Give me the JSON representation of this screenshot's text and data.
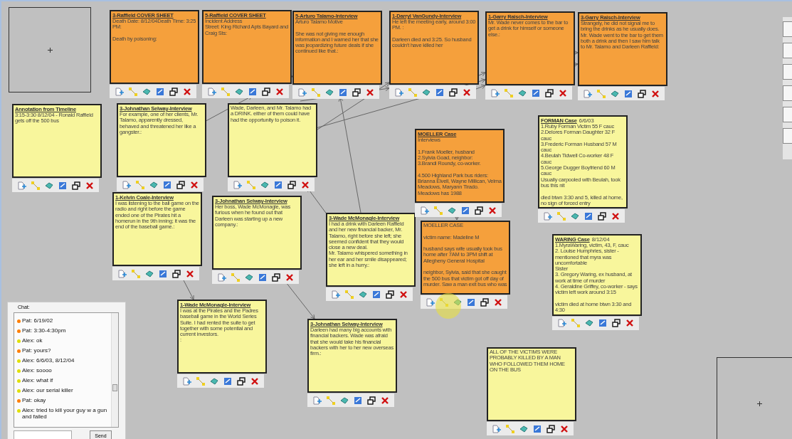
{
  "notes": [
    {
      "title": "3-Raffield COVER SHEET",
      "text": "Death Date: 8/12/04Death Time: 3:25 PM:\n\nDeath by poisoning:",
      "color": "#f5a03c"
    },
    {
      "title": "5-Raffield COVER SHEET",
      "text": "Incident Address\nStreet: King Richard Apts Bayard and Craig Sts:",
      "color": "#f5a03c"
    },
    {
      "title": "5-Arturo Talamo-Interview",
      "text": "Arturo Talamo Motive\n\nShe was not giving me enough information and I warned her that she was jeopardizing future deals if she continued like that.:",
      "color": "#f5a03c"
    },
    {
      "title": "1-Darryl VanGundy-Interview",
      "text": "He left the meeting early, around 3:00 PM. :\n\nDarleen died and 3:25. So husband couldn't have killed her",
      "color": "#f5a03c"
    },
    {
      "title": "1-Garry Raisch-Interview",
      "text": "Mr. Wade never comes to the bar to get a drink for himself or someone else.:",
      "color": "#f5a03c"
    },
    {
      "title": "3-Garry Raisch-Interview",
      "text": "Strangely, he did not signal me to bring the drinks as he usually does.\nMr. Wade went to the bar to get them both a drink and then I saw him talk to Mr. Talamo and Darleen Raffield:",
      "color": "#f5a03c"
    },
    {
      "title": "Annotation from Timeline",
      "text": "3:15-3:30 8/12/04 - Ronald Raffield gets off the 500 bus",
      "color": "#f8f69c"
    },
    {
      "title": "3-Johnathan Selway-Interview",
      "text": "For example, one of her clients, Mr. Talamo, apparently dressed, behaved and threatened her like a gangster.:",
      "color": "#f8f69c"
    },
    {
      "text": "Wade, Darleen, and Mr. Talamo had a DRINK. either of them could have had the opportunity to poison it.",
      "color": "#f8f69c"
    },
    {
      "title": "1-Kelvin Coale-Interview",
      "text": "I was listening to the ball game on the radio and right before the game ended one of the Pirates hit a homerun in the 9th inning; it was the end of the baseball game.:",
      "color": "#f8f69c"
    },
    {
      "title": "3-Johnathan Selway-Interview",
      "text": "Her boss, Wade McMonagle, was furious when he found out that Darleen was starting up a new company.:",
      "color": "#f8f69c"
    },
    {
      "title": "3-Wade McMonagle-Interview",
      "text": "I had a drink with Darleen Raffield and her new financial backer, Mr. Talamo, right before she left; she seemed confident that they would close a new deal.\nMr. Talamo whispered something in her ear and her smile disappeared; she left in a hurry.:",
      "color": "#f8f69c"
    },
    {
      "title": "MOELLER Case",
      "text": "Interviews\n\n1.Frank Moeller, husband\n2.Sylvia Goad, neighbor:\n3.Brandi Roundy, co-worker.\n\n4.500 Highland Park bus riders: Brianna Elvell, Wayne Millican, Velma Meadows, Maryann Tirado. Meadows has 1988",
      "color": "#f5a03c"
    },
    {
      "text": "MOELLER CASE\n\nvictim name: Madeline M\n\nhusband says wife usually took bus home after 7AM to 3PM shift at Allegheny General Hospital\n\nneighbor, Sylvia, said that she caught the 500 bus that victim got off day of murder. Saw a man exit bus who was",
      "color": "#f5a03c"
    },
    {
      "title": "FORMAN Case",
      "date": "6/6/03",
      "text": "1.Ruby Forman Victim 55 F cauc\n2.Delores Forman Daughter 32 F cauc\n3.Frederic Forman Husband 57 M cauc\n4.Beulah Tidwell Co-worker 48 F cauc\n5.George Dugger Boyfriend 60 M cauc\nUsually carpooled with Beulah, took bus this nit\n\ndied btwn 3:30 and 5, killed at home, no sign of forced entry",
      "color": "#f8f69c"
    },
    {
      "title": "WARING Case",
      "date": "8/12/04",
      "text": "1.MyraWaring, victim, 43, F, cauc\n2. Louise Humphries, sister - mentioned that myra was uncomfortable\nSister\n3. Gregory Waring, ex husband, at work at time of murder\n4. Geraldine Griffey, co-worker - says victim left work around 3:15\n\nvictim died at home btwn 3:30 and 4:30",
      "color": "#f8f69c"
    },
    {
      "title": "1-Wade McMonagle-Interview",
      "text": "I was at the Pirates and the Padres baseball game in the World Series Suite. I had rented the suite to get together with some potential and current investors.\n:",
      "color": "#f8f69c"
    },
    {
      "title": "3-Johnathan Selway-Interview",
      "text": "Darleen had many big accounts with financial backers. Wade was afraid that she would take his financial backers with her to her new overseas firm.:",
      "color": "#f8f69c"
    },
    {
      "text": "ALL OF THE VICTIMS WERE PROBABLY KILLED BY A MAN WHO FOLLOWED THEM HOME ON THE BUS",
      "color": "#f8f69c"
    }
  ],
  "chat": {
    "label": "Chat:",
    "messages": [
      {
        "text": "Pat: 6/19/02",
        "color": "#ff7f00"
      },
      {
        "text": "Pat: 3:30-4:30pm",
        "color": "#ff7f00"
      },
      {
        "text": "Alex: ok",
        "color": "#e0e000"
      },
      {
        "text": "Pat: yours?",
        "color": "#ff7f00"
      },
      {
        "text": "Alex: 6/6/03, 8/12/04",
        "color": "#e0e000"
      },
      {
        "text": "Alex: soooo",
        "color": "#e0e000"
      },
      {
        "text": "Alex: what if",
        "color": "#e0e000"
      },
      {
        "text": "Alex: our serial killer",
        "color": "#e0e000"
      },
      {
        "text": "Pat: okay",
        "color": "#ff7f00"
      },
      {
        "text": "Alex: tried to kill your guy w a gun and failed",
        "color": "#e0e000"
      }
    ],
    "send": "Send"
  }
}
